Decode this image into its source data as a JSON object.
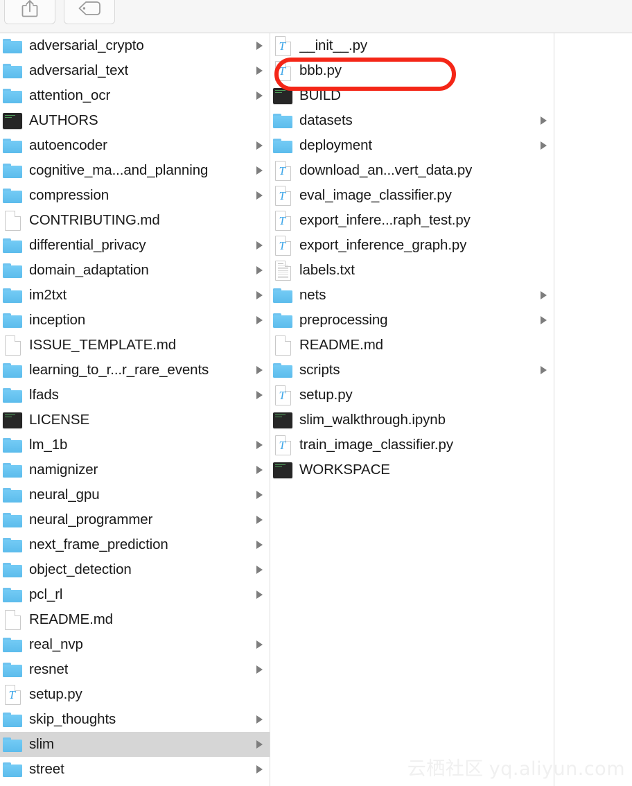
{
  "toolbar": {
    "buttons": [
      {
        "name": "share-button",
        "icon": "share-icon",
        "label": ""
      },
      {
        "name": "tag-button",
        "icon": "tag-icon",
        "label": ""
      }
    ]
  },
  "annotation": {
    "type": "red-rounded-rect-highlight",
    "color": "#f42617",
    "targets": "bbb.py"
  },
  "watermark": {
    "chinese": "云栖社区",
    "domain": "yq.aliyun.com",
    "color": "#f0f0f0"
  },
  "colors": {
    "folder": "#63c4f2",
    "selection": "#d6d6d6",
    "text": "#191919",
    "arrow": "#7d7d7d",
    "divider": "#dcdcdc",
    "toolbar_bg": "#f6f6f6",
    "annotation": "#f42617"
  },
  "columns": [
    {
      "name": "column-repo-root",
      "items": [
        {
          "label": "adversarial_crypto",
          "icon": "folder-icon",
          "arrow": true,
          "selected": false
        },
        {
          "label": "adversarial_text",
          "icon": "folder-icon",
          "arrow": true,
          "selected": false
        },
        {
          "label": "attention_ocr",
          "icon": "folder-icon",
          "arrow": true,
          "selected": false
        },
        {
          "label": "AUTHORS",
          "icon": "dark-doc-icon",
          "arrow": false,
          "selected": false
        },
        {
          "label": "autoencoder",
          "icon": "folder-icon",
          "arrow": true,
          "selected": false
        },
        {
          "label": "cognitive_ma...and_planning",
          "icon": "folder-icon",
          "arrow": true,
          "selected": false
        },
        {
          "label": "compression",
          "icon": "folder-icon",
          "arrow": true,
          "selected": false
        },
        {
          "label": "CONTRIBUTING.md",
          "icon": "blank-page-icon",
          "arrow": false,
          "selected": false
        },
        {
          "label": "differential_privacy",
          "icon": "folder-icon",
          "arrow": true,
          "selected": false
        },
        {
          "label": "domain_adaptation",
          "icon": "folder-icon",
          "arrow": true,
          "selected": false
        },
        {
          "label": "im2txt",
          "icon": "folder-icon",
          "arrow": true,
          "selected": false
        },
        {
          "label": "inception",
          "icon": "folder-icon",
          "arrow": true,
          "selected": false
        },
        {
          "label": "ISSUE_TEMPLATE.md",
          "icon": "blank-page-icon",
          "arrow": false,
          "selected": false
        },
        {
          "label": "learning_to_r...r_rare_events",
          "icon": "folder-icon",
          "arrow": true,
          "selected": false
        },
        {
          "label": "lfads",
          "icon": "folder-icon",
          "arrow": true,
          "selected": false
        },
        {
          "label": "LICENSE",
          "icon": "dark-doc-icon",
          "arrow": false,
          "selected": false
        },
        {
          "label": "lm_1b",
          "icon": "folder-icon",
          "arrow": true,
          "selected": false
        },
        {
          "label": "namignizer",
          "icon": "folder-icon",
          "arrow": true,
          "selected": false
        },
        {
          "label": "neural_gpu",
          "icon": "folder-icon",
          "arrow": true,
          "selected": false
        },
        {
          "label": "neural_programmer",
          "icon": "folder-icon",
          "arrow": true,
          "selected": false
        },
        {
          "label": "next_frame_prediction",
          "icon": "folder-icon",
          "arrow": true,
          "selected": false
        },
        {
          "label": "object_detection",
          "icon": "folder-icon",
          "arrow": true,
          "selected": false
        },
        {
          "label": "pcl_rl",
          "icon": "folder-icon",
          "arrow": true,
          "selected": false
        },
        {
          "label": "README.md",
          "icon": "blank-page-icon",
          "arrow": false,
          "selected": false
        },
        {
          "label": "real_nvp",
          "icon": "folder-icon",
          "arrow": true,
          "selected": false
        },
        {
          "label": "resnet",
          "icon": "folder-icon",
          "arrow": true,
          "selected": false
        },
        {
          "label": "setup.py",
          "icon": "python-file-icon",
          "arrow": false,
          "selected": false
        },
        {
          "label": "skip_thoughts",
          "icon": "folder-icon",
          "arrow": true,
          "selected": false
        },
        {
          "label": "slim",
          "icon": "folder-icon",
          "arrow": true,
          "selected": true
        },
        {
          "label": "street",
          "icon": "folder-icon",
          "arrow": true,
          "selected": false
        }
      ]
    },
    {
      "name": "column-slim-contents",
      "items": [
        {
          "label": "__init__.py",
          "icon": "python-file-icon",
          "arrow": false,
          "selected": false
        },
        {
          "label": "bbb.py",
          "icon": "python-file-icon",
          "arrow": false,
          "selected": false,
          "highlighted": true
        },
        {
          "label": "BUILD",
          "icon": "dark-doc-icon",
          "arrow": false,
          "selected": false
        },
        {
          "label": "datasets",
          "icon": "folder-icon",
          "arrow": true,
          "selected": false
        },
        {
          "label": "deployment",
          "icon": "folder-icon",
          "arrow": true,
          "selected": false
        },
        {
          "label": "download_an...vert_data.py",
          "icon": "python-file-icon",
          "arrow": false,
          "selected": false
        },
        {
          "label": "eval_image_classifier.py",
          "icon": "python-file-icon",
          "arrow": false,
          "selected": false
        },
        {
          "label": "export_infere...raph_test.py",
          "icon": "python-file-icon",
          "arrow": false,
          "selected": false
        },
        {
          "label": "export_inference_graph.py",
          "icon": "python-file-icon",
          "arrow": false,
          "selected": false
        },
        {
          "label": "labels.txt",
          "icon": "text-page-icon",
          "arrow": false,
          "selected": false
        },
        {
          "label": "nets",
          "icon": "folder-icon",
          "arrow": true,
          "selected": false
        },
        {
          "label": "preprocessing",
          "icon": "folder-icon",
          "arrow": true,
          "selected": false
        },
        {
          "label": "README.md",
          "icon": "blank-page-icon",
          "arrow": false,
          "selected": false
        },
        {
          "label": "scripts",
          "icon": "folder-icon",
          "arrow": true,
          "selected": false
        },
        {
          "label": "setup.py",
          "icon": "python-file-icon",
          "arrow": false,
          "selected": false
        },
        {
          "label": "slim_walkthrough.ipynb",
          "icon": "dark-doc-icon",
          "arrow": false,
          "selected": false
        },
        {
          "label": "train_image_classifier.py",
          "icon": "python-file-icon",
          "arrow": false,
          "selected": false
        },
        {
          "label": "WORKSPACE",
          "icon": "dark-doc-icon",
          "arrow": false,
          "selected": false
        }
      ]
    },
    {
      "name": "column-preview-empty",
      "items": []
    }
  ]
}
